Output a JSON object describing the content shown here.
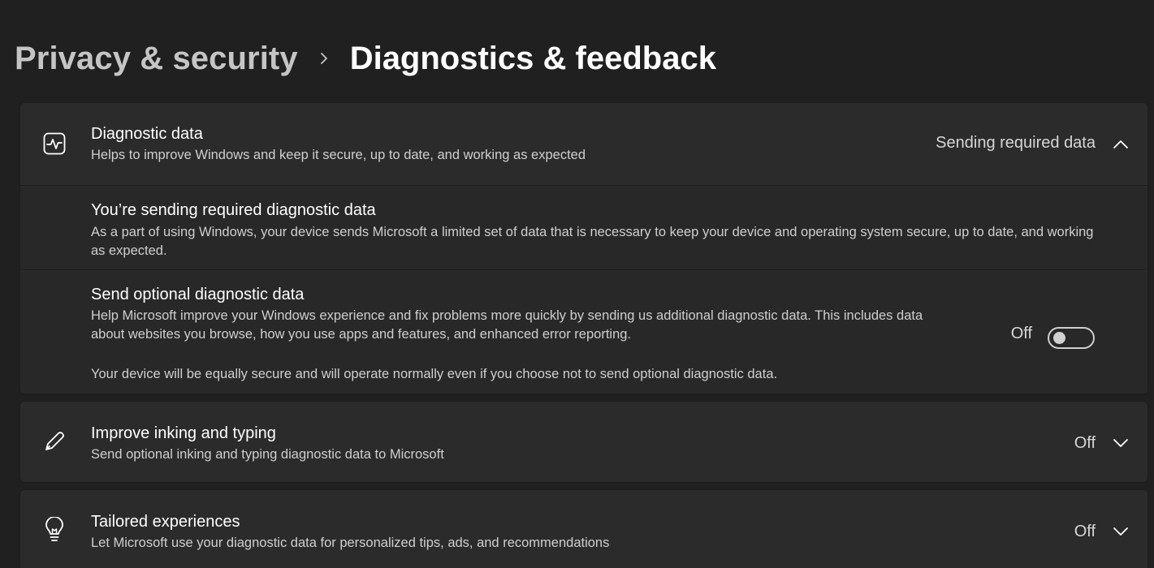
{
  "breadcrumb": {
    "parent": "Privacy & security",
    "current": "Diagnostics & feedback"
  },
  "diagnostic_data": {
    "icon": "activity-monitor-icon",
    "title": "Diagnostic data",
    "description": "Helps to improve Windows and keep it secure, up to date, and working as expected",
    "status": "Sending required data",
    "expanded": true,
    "required": {
      "title": "You’re sending required diagnostic data",
      "description": "As a part of using Windows, your device sends Microsoft a limited set of data that is necessary to keep your device and operating system secure, up to date, and working as expected."
    },
    "optional": {
      "title": "Send optional diagnostic data",
      "description": "Help Microsoft improve your Windows experience and fix problems more quickly by sending us additional diagnostic data. This includes data about websites you browse, how you use apps and features, and enhanced error reporting.",
      "note": "Your device will be equally secure and will operate normally even if you choose not to send optional diagnostic data.",
      "toggle_label": "Off",
      "toggle_on": false
    }
  },
  "inking": {
    "icon": "pen-icon",
    "title": "Improve inking and typing",
    "description": "Send optional inking and typing diagnostic data to Microsoft",
    "status": "Off"
  },
  "tailored": {
    "icon": "lightbulb-icon",
    "title": "Tailored experiences",
    "description": "Let Microsoft use your diagnostic data for personalized tips, ads, and recommendations",
    "status": "Off"
  },
  "colors": {
    "background": "#202020",
    "card": "#2b2b2b",
    "expanded_row": "#282828",
    "text_primary": "#ffffff",
    "text_secondary": "#cfcfcf"
  }
}
